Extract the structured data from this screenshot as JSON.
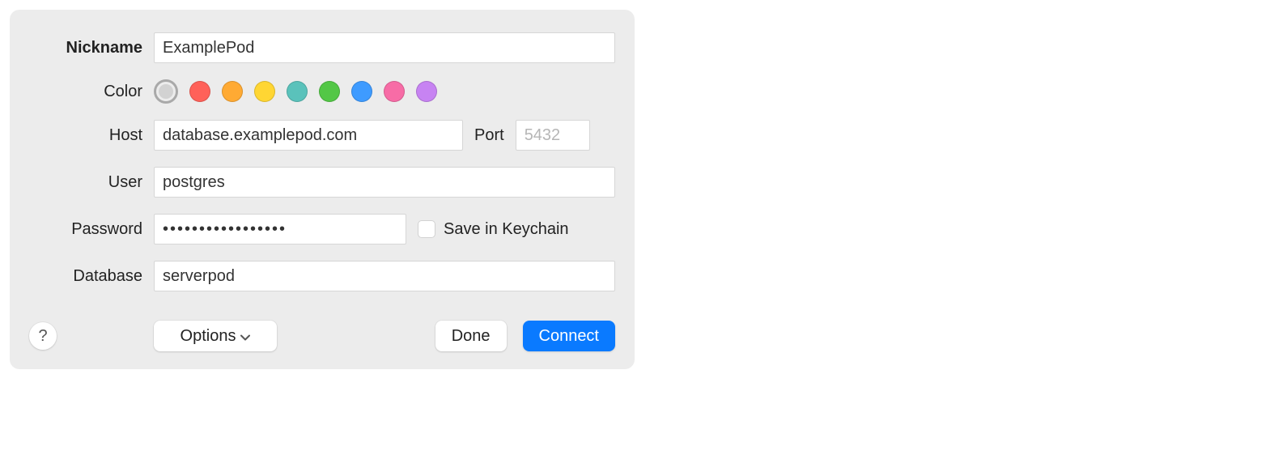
{
  "form": {
    "nickname": {
      "label": "Nickname",
      "value": "ExamplePod"
    },
    "color": {
      "label": "Color",
      "swatches": [
        {
          "name": "gray",
          "color": "#d2d2d2",
          "selected": true
        },
        {
          "name": "red",
          "color": "#ff6159"
        },
        {
          "name": "orange",
          "color": "#ffaa33"
        },
        {
          "name": "yellow",
          "color": "#ffd633"
        },
        {
          "name": "teal",
          "color": "#5ac2bb"
        },
        {
          "name": "green",
          "color": "#53c746"
        },
        {
          "name": "blue",
          "color": "#3e9bff"
        },
        {
          "name": "pink",
          "color": "#f76ca6"
        },
        {
          "name": "purple",
          "color": "#c783f2"
        }
      ]
    },
    "host": {
      "label": "Host",
      "value": "database.examplepod.com"
    },
    "port": {
      "label": "Port",
      "placeholder": "5432",
      "value": ""
    },
    "user": {
      "label": "User",
      "value": "postgres"
    },
    "password": {
      "label": "Password",
      "value": "•••••••••••••••••"
    },
    "save_keychain": {
      "label": "Save in Keychain",
      "checked": false
    },
    "database": {
      "label": "Database",
      "value": "serverpod"
    }
  },
  "footer": {
    "help_symbol": "?",
    "options": "Options",
    "done": "Done",
    "connect": "Connect"
  }
}
